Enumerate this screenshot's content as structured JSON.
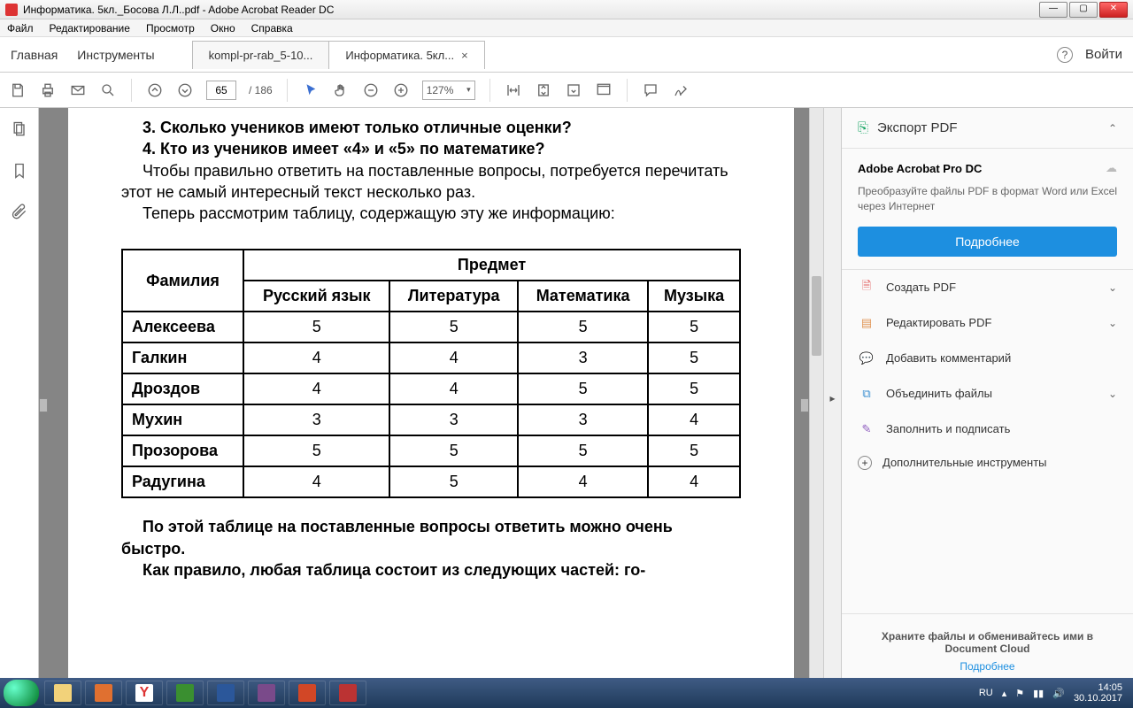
{
  "window": {
    "title": "Информатика. 5кл._Босова Л.Л..pdf - Adobe Acrobat Reader DC",
    "min": "—",
    "max": "▢",
    "close": "✕"
  },
  "menu": {
    "file": "Файл",
    "edit": "Редактирование",
    "view": "Просмотр",
    "window": "Окно",
    "help": "Справка"
  },
  "topbar": {
    "home": "Главная",
    "tools": "Инструменты",
    "tab1": "kompl-pr-rab_5-10...",
    "tab2": "Информатика. 5кл...",
    "login": "Войти"
  },
  "toolbar": {
    "page": "65",
    "pages": "/ 186",
    "zoom": "127%"
  },
  "doc": {
    "q3": "3. Сколько учеников имеют только отличные оценки?",
    "q4": "4. Кто из учеников имеет «4» и «5» по математике?",
    "p1": "Чтобы правильно ответить на поставленные вопросы, потребуется перечитать этот не самый интересный текст несколько раз.",
    "p2": "Теперь рассмотрим таблицу, содержащую эту же информацию:",
    "p3": "По этой таблице на поставленные вопросы ответить можно очень быстро.",
    "p4": "Как правило, любая таблица состоит из следующих частей: го-"
  },
  "chart_data": {
    "type": "table",
    "title": "Предмет",
    "row_header": "Фамилия",
    "columns": [
      "Русский язык",
      "Литература",
      "Математика",
      "Музыка"
    ],
    "rows": [
      {
        "name": "Алексеева",
        "vals": [
          "5",
          "5",
          "5",
          "5"
        ]
      },
      {
        "name": "Галкин",
        "vals": [
          "4",
          "4",
          "3",
          "5"
        ]
      },
      {
        "name": "Дроздов",
        "vals": [
          "4",
          "4",
          "5",
          "5"
        ]
      },
      {
        "name": "Мухин",
        "vals": [
          "3",
          "3",
          "3",
          "4"
        ]
      },
      {
        "name": "Прозорова",
        "vals": [
          "5",
          "5",
          "5",
          "5"
        ]
      },
      {
        "name": "Радугина",
        "vals": [
          "4",
          "5",
          "4",
          "4"
        ]
      }
    ]
  },
  "right": {
    "export": "Экспорт PDF",
    "pro": "Adobe Acrobat Pro DC",
    "prosub": "Преобразуйте файлы PDF в формат Word или Excel через Интернет",
    "more": "Подробнее",
    "create": "Создать PDF",
    "edit": "Редактировать PDF",
    "comment": "Добавить комментарий",
    "combine": "Объединить файлы",
    "fill": "Заполнить и подписать",
    "extra": "Дополнительные инструменты",
    "cloud": "Храните файлы и обменивайтесь ими в Document Cloud",
    "cloudlink": "Подробнее"
  },
  "tray": {
    "lang": "RU",
    "time": "14:05",
    "date": "30.10.2017"
  }
}
